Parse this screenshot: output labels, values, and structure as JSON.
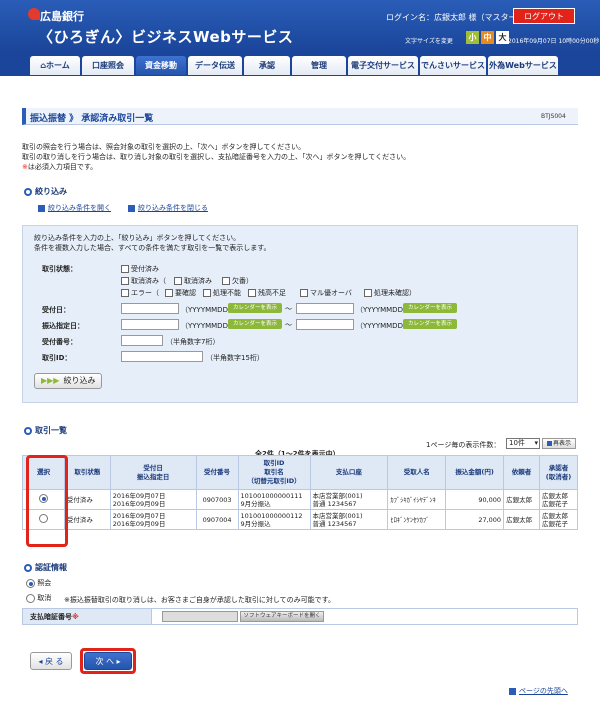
{
  "header": {
    "bank_name": "広島銀行",
    "service_name": "〈ひろぎん〉ビジネスWebサービス",
    "login_user": "ログイン名：広銀太郎 様（マスターユーザ）",
    "logout_label": "ログアウト",
    "font_size_label": "文字サイズを変更",
    "font_small": "小",
    "font_medium": "中",
    "font_large": "大",
    "datetime": "2016年09月07日 10時00分00秒"
  },
  "nav": {
    "tabs": [
      {
        "label": "ホーム"
      },
      {
        "label": "口座照会"
      },
      {
        "label": "資金移動"
      },
      {
        "label": "データ伝送"
      },
      {
        "label": "承認"
      },
      {
        "label": "管理"
      },
      {
        "label": "電子交付サービス"
      },
      {
        "label": "でんさいサービス"
      },
      {
        "label": "外為Webサービス"
      }
    ]
  },
  "page": {
    "title": "振込振替 》 承認済み取引一覧",
    "screen_id": "BTJS004",
    "instructions": [
      "取引の照会を行う場合は、照会対象の取引を選択の上、「次へ」ボタンを押してください。",
      "取引の取り消しを行う場合は、取り消し対象の取引を選択し、支払暗証番号を入力の上、「次へ」ボタンを押してください。"
    ],
    "required_note_mark": "※",
    "required_note": "は必須入力項目です。"
  },
  "filter": {
    "heading": "絞り込み",
    "open_link": "絞り込み条件を開く",
    "close_link": "絞り込み条件を閉じる",
    "help1": "絞り込み条件を入力の上、「絞り込み」ボタンを押してください。",
    "help2": "条件を複数入力した場合、すべての条件を満たす取引を一覧で表示します。",
    "status_label": "取引状態：",
    "status_options": {
      "accepted": "受付済み",
      "cancelled": "取消済み（",
      "cancel_done": "取消済み",
      "missing": "欠番",
      "close_paren": "）",
      "error_open": "エラー（",
      "pending_confirm": "要確認",
      "unprocessable": "処理不能",
      "insufficient": "残高不足",
      "multi_over": "マル優オーバ",
      "unconfirmed": "処理未確認",
      "error_close": "）"
    },
    "accept_date_label": "受付日：",
    "transfer_date_label": "振込指定日：",
    "date_format": "（YYYYMMDD）",
    "calendar_btn": "カレンダーを表示",
    "range_sep": "〜",
    "accept_no_label": "受付番号：",
    "accept_no_hint": "（半角数字7桁）",
    "tx_id_label": "取引ID：",
    "tx_id_hint": "（半角数字15桁）",
    "submit_label": "絞り込み"
  },
  "list": {
    "heading": "取引一覧",
    "per_page_label": "1ページ毎の表示件数：",
    "per_page_value": "10件",
    "redisplay_label": "再表示",
    "count_text": "全2件（1〜2件を表示中）",
    "columns": {
      "select": "選択",
      "status": "取引状態",
      "date1": "受付日",
      "date2": "振込指定日",
      "accept_no": "受付番号",
      "txid1": "取引ID",
      "txid2": "取引名",
      "txid3": "（切替元取引ID）",
      "account": "支払口座",
      "recipient": "受取人名",
      "amount": "振込金額(円)",
      "requester": "依頼者",
      "approver1": "承認者",
      "approver2": "(取消者)"
    },
    "rows": [
      {
        "status": "受付済み",
        "accept_date": "2016年09月07日",
        "transfer_date": "2016年09月09日",
        "accept_no": "0907003",
        "tx_id": "101001000000111",
        "tx_name": "9月分振込",
        "branch": "本店営業部(001)",
        "account_no": "普通 1234567",
        "recipient": "ｶﾌﾞｼｷｶﾞｲｼﾔﾃﾞﾝｷ",
        "amount": "90,000",
        "requester": "広銀太郎",
        "approver1": "広銀太郎",
        "approver2": "広銀花子"
      },
      {
        "status": "受付済み",
        "accept_date": "2016年09月07日",
        "transfer_date": "2016年09月09日",
        "accept_no": "0907004",
        "tx_id": "101001000000112",
        "tx_name": "9月分振込",
        "branch": "本店営業部(001)",
        "account_no": "普通 1234567",
        "recipient": "ﾋﾛｷﾞﾝｹﾝｾﾂｶﾌﾞ",
        "amount": "27,000",
        "requester": "広銀太郎",
        "approver1": "広銀太郎",
        "approver2": "広銀花子"
      }
    ]
  },
  "auth": {
    "heading": "認証情報",
    "inquiry_label": "照会",
    "cancel_label": "取消",
    "cancel_note": "※振込振替取引の取り消しは、お客さまご自身が承認した取引に対してのみ可能です。",
    "pin_label": "支払暗証番号",
    "pin_mark": "※",
    "soft_kb_label": "ソフトウェアキーボードを開く"
  },
  "footer": {
    "back_label": "戻 る",
    "next_label": "次 へ",
    "page_top_label": "ページの先頭へ"
  },
  "colors": {
    "brand": "#1a459a",
    "accent_green": "#8db83a",
    "highlight": "#e2231a"
  }
}
